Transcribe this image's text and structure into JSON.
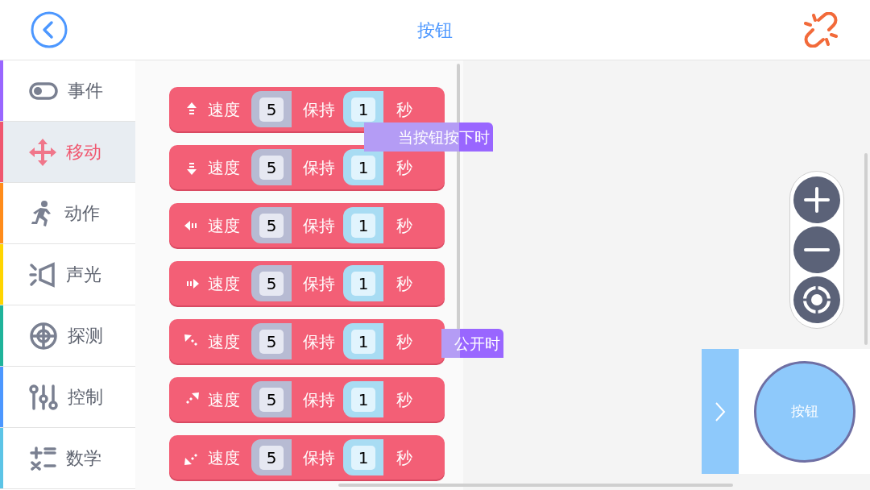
{
  "header": {
    "title": "按钮"
  },
  "sidebar": {
    "items": [
      {
        "label": "事件",
        "color": "#9966ff",
        "selected": false
      },
      {
        "label": "移动",
        "color": "#f0576f",
        "selected": true
      },
      {
        "label": "动作",
        "color": "#ff8c1a",
        "selected": false
      },
      {
        "label": "声光",
        "color": "#ffd500",
        "selected": false
      },
      {
        "label": "探测",
        "color": "#1fb39a",
        "selected": false
      },
      {
        "label": "控制",
        "color": "#4c97ff",
        "selected": false
      },
      {
        "label": "数学",
        "color": "#5cc4e6",
        "selected": false
      }
    ]
  },
  "blocks": [
    {
      "speed_label": "速度",
      "speed": "5",
      "hold_label": "保持",
      "hold": "1",
      "unit": "秒"
    },
    {
      "speed_label": "速度",
      "speed": "5",
      "hold_label": "保持",
      "hold": "1",
      "unit": "秒"
    },
    {
      "speed_label": "速度",
      "speed": "5",
      "hold_label": "保持",
      "hold": "1",
      "unit": "秒"
    },
    {
      "speed_label": "速度",
      "speed": "5",
      "hold_label": "保持",
      "hold": "1",
      "unit": "秒"
    },
    {
      "speed_label": "速度",
      "speed": "5",
      "hold_label": "保持",
      "hold": "1",
      "unit": "秒"
    },
    {
      "speed_label": "速度",
      "speed": "5",
      "hold_label": "保持",
      "hold": "1",
      "unit": "秒"
    },
    {
      "speed_label": "速度",
      "speed": "5",
      "hold_label": "保持",
      "hold": "1",
      "unit": "秒"
    }
  ],
  "workspace_blocks": [
    {
      "text": "当按钮按下时"
    },
    {
      "text": "公开时"
    }
  ],
  "device_panel": {
    "button_label": "按钮"
  }
}
